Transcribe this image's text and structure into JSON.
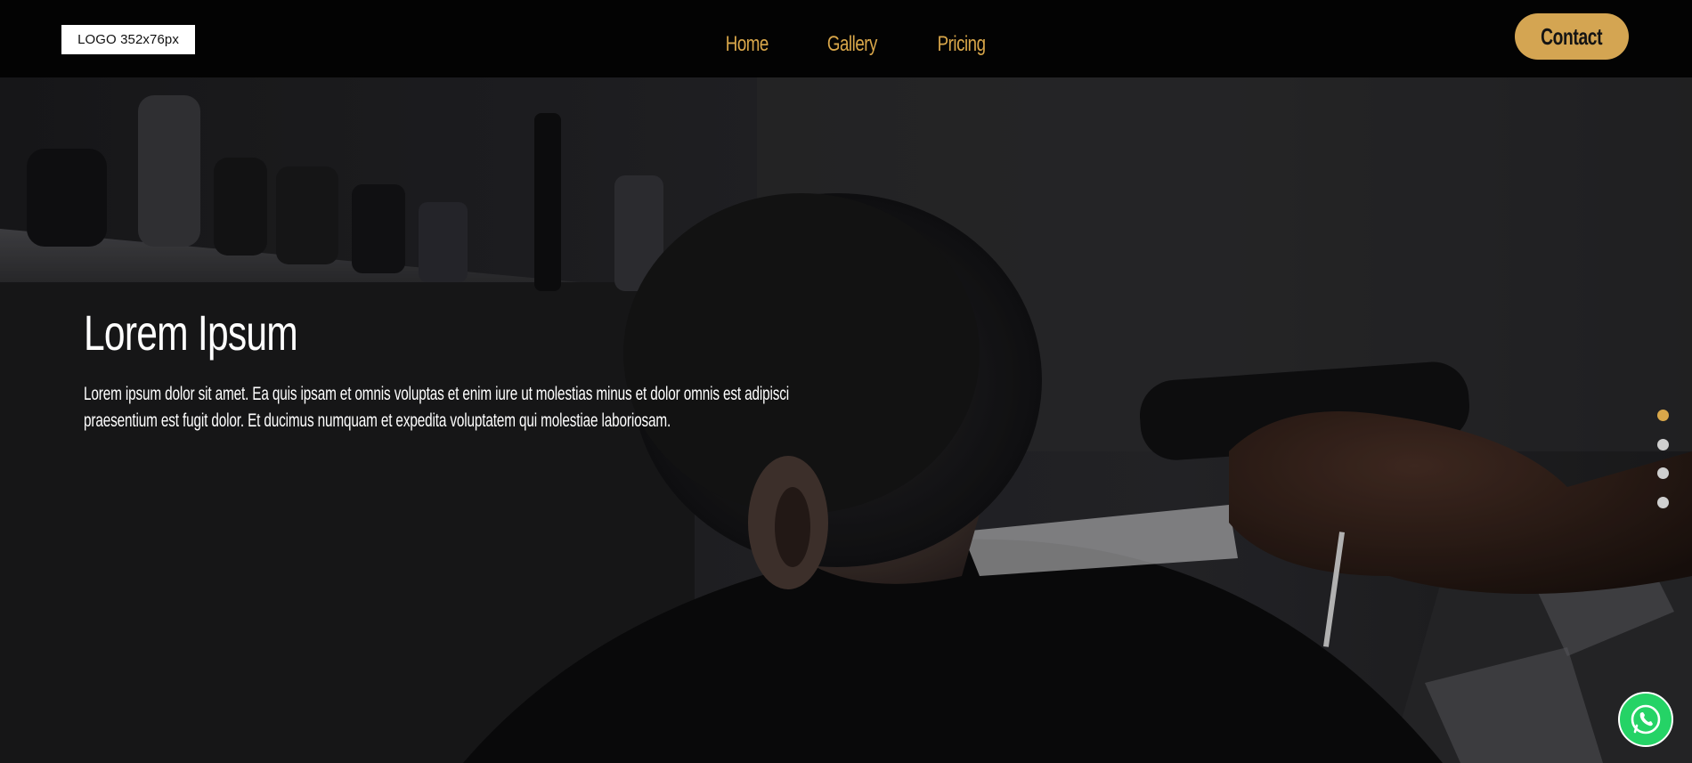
{
  "header": {
    "logo_text": "LOGO 352x76px",
    "nav": [
      {
        "label": "Home"
      },
      {
        "label": "Gallery"
      },
      {
        "label": "Pricing"
      }
    ],
    "contact_label": "Contact"
  },
  "hero": {
    "title": "Lorem Ipsum",
    "text": "Lorem ipsum dolor sit amet. Ea quis ipsam et omnis voluptas et enim iure ut molestias minus et dolor omnis est adipisci praesentium est fugit dolor. Et ducimus numquam et expedita voluptatem qui molestiae laboriosam.",
    "slides": {
      "count": 4,
      "active_index": 0
    }
  },
  "floating": {
    "whatsapp_icon": "whatsapp-icon"
  },
  "colors": {
    "accent": "#d9a74a",
    "header_bg": "#030303",
    "whatsapp": "#25d366"
  }
}
